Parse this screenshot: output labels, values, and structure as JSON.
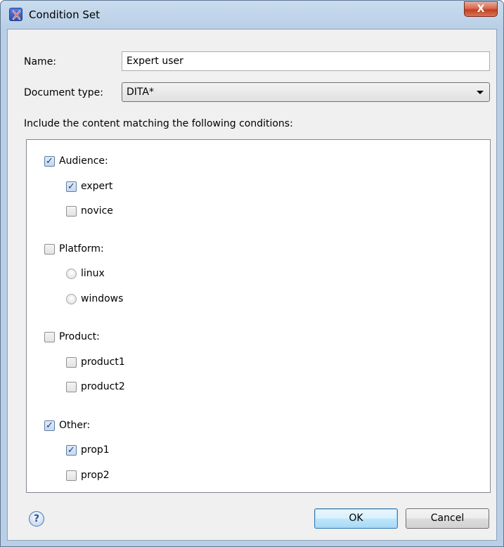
{
  "window": {
    "title": "Condition Set",
    "close_label": "X"
  },
  "form": {
    "name_label": "Name:",
    "name_value": "Expert user",
    "doctype_label": "Document type:",
    "doctype_value": "DITA*",
    "include_label": "Include the content matching the following conditions:"
  },
  "conditions": {
    "audience": {
      "label": "Audience:",
      "checked": true,
      "items": [
        {
          "label": "expert",
          "checked": true
        },
        {
          "label": "novice",
          "checked": false
        }
      ]
    },
    "platform": {
      "label": "Platform:",
      "checked": false,
      "items": [
        {
          "label": "linux",
          "selected": false
        },
        {
          "label": "windows",
          "selected": false
        }
      ]
    },
    "product": {
      "label": "Product:",
      "checked": false,
      "items": [
        {
          "label": "product1",
          "checked": false
        },
        {
          "label": "product2",
          "checked": false
        }
      ]
    },
    "other": {
      "label": "Other:",
      "checked": true,
      "items": [
        {
          "label": "prop1",
          "checked": true
        },
        {
          "label": "prop2",
          "checked": false
        }
      ]
    }
  },
  "buttons": {
    "help_label": "?",
    "ok_label": "OK",
    "cancel_label": "Cancel"
  },
  "icons": {
    "app": "oxygen-x-icon",
    "help": "help-icon",
    "dropdown": "chevron-down-icon"
  },
  "colors": {
    "titlebar": "#c9dcef",
    "accent": "#3c7fb1",
    "close": "#c2401f"
  }
}
